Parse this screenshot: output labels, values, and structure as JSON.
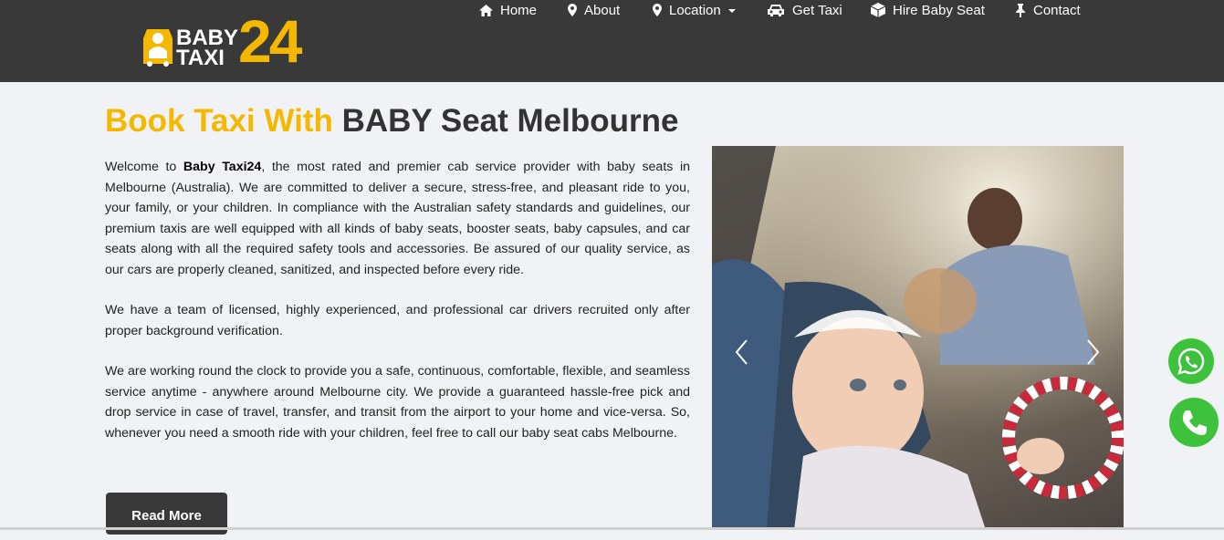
{
  "logo": {
    "word1": "BABY",
    "word2": "TAXI",
    "number": "24",
    "badge_icon": "car-seat-taxi-icon",
    "accent_color": "#f5b800"
  },
  "nav": {
    "items": [
      {
        "label": "Home",
        "icon": "home-icon"
      },
      {
        "label": "About",
        "icon": "map-marker-icon"
      },
      {
        "label": "Location",
        "icon": "map-marker-icon",
        "dropdown": true
      },
      {
        "label": "Get Taxi",
        "icon": "car-icon"
      },
      {
        "label": "Hire Baby Seat",
        "icon": "cube-icon"
      },
      {
        "label": "Contact",
        "icon": "pin-icon"
      }
    ],
    "bg_color": "#393939"
  },
  "main": {
    "heading_highlight": "Book Taxi With",
    "heading_rest": "BABY Seat Melbourne",
    "p1_lead": "Welcome to ",
    "p1_bold": "Baby Taxi24",
    "p1_rest": ", the most rated and premier cab service provider with baby seats in Melbourne (Australia). We are committed to deliver a secure, stress-free, and pleasant ride to you, your family, or your children. In compliance with the Australian safety standards and guidelines, our premium taxis are well equipped with all kinds of baby seats, booster seats, baby capsules, and car seats along with all the required safety tools and accessories. Be assured of our quality service, as our cars are properly cleaned, sanitized, and inspected before every ride.",
    "p2": "We have a team of licensed, highly experienced, and professional car drivers recruited only after proper background verification.",
    "p3": "We are working round the clock to provide you a safe, continuous, comfortable, flexible, and seamless service anytime - anywhere around Melbourne city. We provide a guaranteed hassle-free pick and drop service in case of travel, transfer, and transit from the airport to your home and vice-versa. So, whenever you need a smooth ride with your children, feel free to call our baby seat cabs Melbourne.",
    "read_more": "Read More"
  },
  "carousel": {
    "prev_icon": "chevron-left-icon",
    "next_icon": "chevron-right-icon"
  },
  "floating": {
    "whatsapp_icon": "whatsapp-icon",
    "phone_icon": "phone-icon",
    "color": "#3ec23e"
  }
}
